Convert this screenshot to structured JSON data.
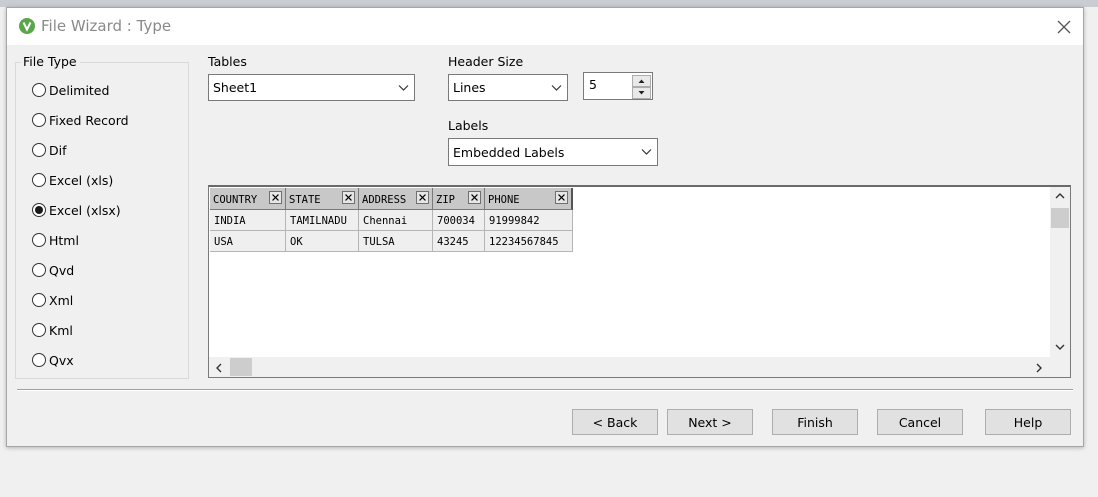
{
  "window": {
    "title": "File Wizard : Type"
  },
  "file_type": {
    "legend": "File Type",
    "options": [
      "Delimited",
      "Fixed Record",
      "Dif",
      "Excel (xls)",
      "Excel (xlsx)",
      "Html",
      "Qvd",
      "Xml",
      "Kml",
      "Qvx"
    ],
    "selected": "Excel (xlsx)"
  },
  "tables": {
    "label": "Tables",
    "value": "Sheet1"
  },
  "header_size": {
    "label": "Header Size",
    "unit": "Lines",
    "value": "5"
  },
  "labels": {
    "label": "Labels",
    "value": "Embedded Labels"
  },
  "preview": {
    "columns": [
      "COUNTRY",
      "STATE",
      "ADDRESS",
      "ZIP",
      "PHONE"
    ],
    "rows": [
      [
        "INDIA",
        "TAMILNADU",
        "Chennai",
        "700034",
        "91999842"
      ],
      [
        "USA",
        "OK",
        "TULSA",
        "43245",
        "12234567845"
      ]
    ]
  },
  "buttons": {
    "back": "< Back",
    "next": "Next >",
    "finish": "Finish",
    "cancel": "Cancel",
    "help": "Help"
  },
  "colors": {
    "app_icon": "#5aa64b",
    "header_cell": "#c8c8c8",
    "data_cell": "#efefef"
  }
}
